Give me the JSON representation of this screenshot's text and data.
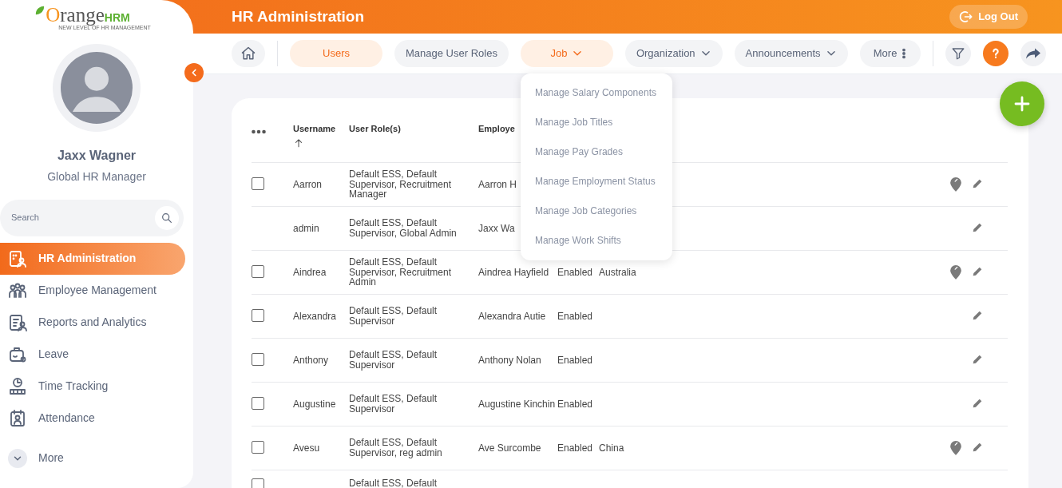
{
  "logo": {
    "name": "Orange",
    "suffix": "HRM",
    "tagline": "NEW LEVEL OF HR MANAGEMENT"
  },
  "user": {
    "name": "Jaxx Wagner",
    "role": "Global HR Manager"
  },
  "sidebar_search": {
    "placeholder": "Search"
  },
  "sidebar": {
    "items": [
      {
        "label": "HR Administration",
        "selected": true
      },
      {
        "label": "Employee Management",
        "selected": false
      },
      {
        "label": "Reports and Analytics",
        "selected": false
      },
      {
        "label": "Leave",
        "selected": false
      },
      {
        "label": "Time Tracking",
        "selected": false
      },
      {
        "label": "Attendance",
        "selected": false
      }
    ],
    "more": "More"
  },
  "header": {
    "title": "HR Administration",
    "logout": "Log Out"
  },
  "tabs": [
    {
      "label": "Users",
      "kind": "link",
      "selected": true
    },
    {
      "label": "Manage User Roles",
      "kind": "link",
      "selected": false
    },
    {
      "label": "Job",
      "kind": "dropdown",
      "selected": true,
      "menu": [
        "Manage Salary Components",
        "Manage Job Titles",
        "Manage Pay Grades",
        "Manage Employment Status",
        "Manage Job Categories",
        "Manage Work Shifts"
      ]
    },
    {
      "label": "Organization",
      "kind": "dropdown",
      "selected": false
    },
    {
      "label": "Announcements",
      "kind": "dropdown",
      "selected": false
    },
    {
      "label": "More",
      "kind": "more",
      "selected": false
    }
  ],
  "table": {
    "columns": [
      "Username",
      "User Role(s)",
      "Employe"
    ],
    "rows": [
      {
        "username": "Aarron",
        "roles": "Default ESS, Default Supervisor, Recruitment Manager",
        "employee": "Aarron H",
        "selectable": true,
        "checked": false,
        "location_marker": true
      },
      {
        "username": "admin",
        "roles": "Default ESS, Default Supervisor, Global Admin",
        "employee": "Jaxx Wa",
        "selectable": false,
        "location_marker": false
      },
      {
        "username": "Aindrea",
        "roles": "Default ESS, Default Supervisor, Recruitment Admin",
        "employee": "Aindrea Hayfield",
        "status": "Enabled",
        "location": "Australia",
        "selectable": true,
        "checked": false,
        "location_marker": true
      },
      {
        "username": "Alexandra",
        "roles": "Default ESS, Default Supervisor",
        "employee": "Alexandra Autie",
        "status": "Enabled",
        "selectable": true,
        "checked": false,
        "location_marker": false
      },
      {
        "username": "Anthony",
        "roles": "Default ESS, Default Supervisor",
        "employee": "Anthony Nolan",
        "status": "Enabled",
        "selectable": true,
        "checked": false,
        "location_marker": false
      },
      {
        "username": "Augustine",
        "roles": "Default ESS, Default Supervisor",
        "employee": "Augustine Kinchin",
        "status": "Enabled",
        "selectable": true,
        "checked": false,
        "location_marker": false
      },
      {
        "username": "Avesu",
        "roles": "Default ESS, Default Supervisor, reg admin",
        "employee": "Ave Surcombe",
        "status": "Enabled",
        "location": "China",
        "selectable": true,
        "checked": false,
        "location_marker": true
      },
      {
        "roles": "Default ESS, Default",
        "selectable": true,
        "checked": false,
        "location_marker": false
      }
    ]
  }
}
